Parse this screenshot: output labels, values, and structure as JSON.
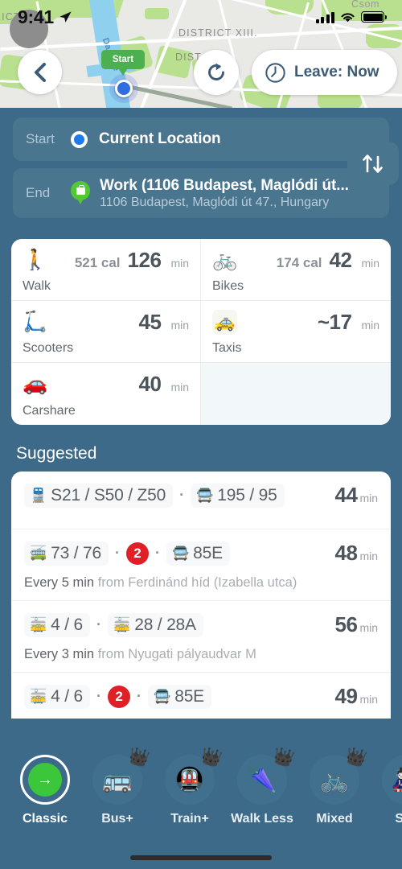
{
  "status_bar": {
    "time": "9:41",
    "location_arrow_icon": "navigation-arrow-icon",
    "signal_icon": "cellular-signal-icon",
    "wifi_icon": "wifi-icon",
    "battery_icon": "battery-full-icon"
  },
  "map": {
    "labels": [
      "RICT II.",
      "DISTRICT XIII.",
      "DIST          IV.",
      "Csom"
    ],
    "river_label": "Danube",
    "start_marker_label": "Start"
  },
  "top_controls": {
    "avatar": "user-avatar",
    "back_icon": "chevron-left-icon",
    "refresh_icon": "refresh-icon",
    "leave_clock_icon": "clock-icon",
    "leave_label": "Leave: Now"
  },
  "route_fields": {
    "start": {
      "tag": "Start",
      "value": "Current Location",
      "dot_icon": "current-location-dot-icon"
    },
    "end": {
      "tag": "End",
      "value": "Work (1106 Budapest, Maglódi út...",
      "subtitle": "1106 Budapest, Maglódi út 47., Hungary",
      "pin_icon": "work-pin-icon"
    },
    "swap_icon": "swap-vertical-icon"
  },
  "modes": [
    {
      "icon": "🚶",
      "icon_name": "walk-icon",
      "label": "Walk",
      "calories": "521 cal",
      "minutes": "126",
      "unit": "min",
      "empty": false
    },
    {
      "icon": "🚲",
      "icon_name": "bike-icon",
      "label": "Bikes",
      "calories": "174 cal",
      "minutes": "42",
      "unit": "min",
      "empty": false
    },
    {
      "icon": "🛴",
      "icon_name": "scooter-icon",
      "label": "Scooters",
      "calories": "",
      "minutes": "45",
      "unit": "min",
      "empty": false
    },
    {
      "icon": "🚕",
      "icon_name": "taxi-icon",
      "label": "Taxis",
      "calories": "",
      "minutes": "~17",
      "unit": "min",
      "empty": false
    },
    {
      "icon": "🚗",
      "icon_name": "carshare-icon",
      "label": "Carshare",
      "calories": "",
      "minutes": "40",
      "unit": "min",
      "empty": false
    },
    {
      "icon": "",
      "icon_name": "empty-cell",
      "label": "",
      "calories": "",
      "minutes": "",
      "unit": "",
      "empty": true
    }
  ],
  "suggested": {
    "title": "Suggested",
    "routes": [
      {
        "legs": [
          {
            "type": "train",
            "icon": "🚆",
            "icon_name": "train-icon",
            "text": "S21 / S50 / Z50"
          },
          {
            "type": "bus",
            "icon": "🚍",
            "icon_name": "bus-icon",
            "text": "195 / 95"
          }
        ],
        "duration": "44",
        "unit": "min",
        "frequency": "",
        "frequency_from": ""
      },
      {
        "legs": [
          {
            "type": "trolley",
            "icon": "🚎",
            "icon_name": "trolleybus-icon",
            "text": "73 / 76"
          },
          {
            "type": "metro",
            "icon": "",
            "icon_name": "metro-line-2-icon",
            "text": "2"
          },
          {
            "type": "bus",
            "icon": "🚍",
            "icon_name": "bus-icon",
            "text": "85E"
          }
        ],
        "duration": "48",
        "unit": "min",
        "frequency": "Every 5 min",
        "frequency_from": "from Ferdinánd híd (Izabella utca)"
      },
      {
        "legs": [
          {
            "type": "tram",
            "icon": "🚋",
            "icon_name": "tram-icon",
            "text": "4 / 6"
          },
          {
            "type": "tram",
            "icon": "🚋",
            "icon_name": "tram-icon",
            "text": "28 / 28A"
          }
        ],
        "duration": "56",
        "unit": "min",
        "frequency": "Every 3 min",
        "frequency_from": "from Nyugati pályaudvar M"
      },
      {
        "legs": [
          {
            "type": "tram",
            "icon": "🚋",
            "icon_name": "tram-icon",
            "text": "4 / 6"
          },
          {
            "type": "metro",
            "icon": "",
            "icon_name": "metro-line-2-icon",
            "text": "2"
          },
          {
            "type": "bus",
            "icon": "🚍",
            "icon_name": "bus-icon",
            "text": "85E"
          }
        ],
        "duration": "49",
        "unit": "min",
        "frequency": "",
        "frequency_from": ""
      }
    ]
  },
  "tabbar": {
    "tabs": [
      {
        "label": "Classic",
        "icon": "",
        "icon_name": "classic-route-icon",
        "active": true,
        "crown": false
      },
      {
        "label": "Bus+",
        "icon": "🚌",
        "icon_name": "bus-plus-icon",
        "active": false,
        "crown": true
      },
      {
        "label": "Train+",
        "icon": "🚇",
        "icon_name": "train-plus-icon",
        "active": false,
        "crown": true
      },
      {
        "label": "Walk Less",
        "icon": "🌂",
        "icon_name": "walk-less-icon",
        "active": false,
        "crown": true
      },
      {
        "label": "Mixed",
        "icon": "🚲",
        "icon_name": "mixed-modes-icon",
        "active": false,
        "crown": true
      },
      {
        "label": "Sim",
        "icon": "🎎",
        "icon_name": "simple-icon",
        "active": false,
        "crown": false
      }
    ],
    "crown_icon": "crown-icon",
    "classic_arrow": "→"
  },
  "colors": {
    "background": "#3d6a89",
    "field": "#4a758f",
    "card": "#ffffff",
    "metro_red": "#e01f27",
    "active_green": "#3cc63c",
    "pin_green": "#53c832"
  }
}
